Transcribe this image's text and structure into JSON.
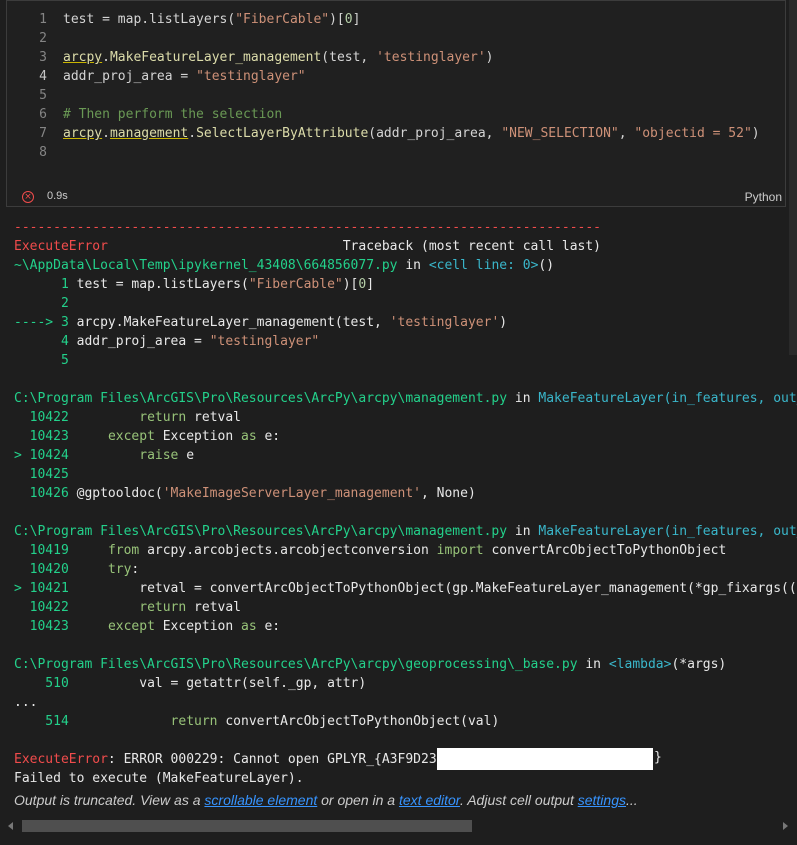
{
  "cell": {
    "lines": [
      {
        "num": "1",
        "parts": [
          [
            "op",
            "test = map.listLayers("
          ],
          [
            "str",
            "\"FiberCable\""
          ],
          [
            "op",
            ")["
          ],
          [
            "num",
            "0"
          ],
          [
            "op",
            "]"
          ]
        ]
      },
      {
        "num": "2",
        "parts": []
      },
      {
        "num": "3",
        "parts": [
          [
            "mod",
            "arcpy"
          ],
          [
            "op",
            "."
          ],
          [
            "k",
            "MakeFeatureLayer_management"
          ],
          [
            "op",
            "(test, "
          ],
          [
            "str",
            "'testinglayer'"
          ],
          [
            "op",
            ")"
          ]
        ]
      },
      {
        "num": "4",
        "parts": [
          [
            "op",
            "addr_proj_area = "
          ],
          [
            "str",
            "\"testinglayer\""
          ]
        ]
      },
      {
        "num": "5",
        "parts": []
      },
      {
        "num": "6",
        "parts": [
          [
            "com",
            "# Then perform the selection"
          ]
        ]
      },
      {
        "num": "7",
        "parts": [
          [
            "mod",
            "arcpy"
          ],
          [
            "op",
            "."
          ],
          [
            "mod",
            "management"
          ],
          [
            "op",
            "."
          ],
          [
            "k",
            "SelectLayerByAttribute"
          ],
          [
            "op",
            "(addr_proj_area, "
          ],
          [
            "str",
            "\"NEW_SELECTION\""
          ],
          [
            "op",
            ", "
          ],
          [
            "str",
            "\"objectid = 52\""
          ],
          [
            "op",
            ")"
          ]
        ]
      },
      {
        "num": "8",
        "parts": []
      }
    ],
    "exec_time": "0.9s",
    "language": "Python",
    "error_icon": "error-circle-icon"
  },
  "output": {
    "lines": [
      [
        [
          "red",
          "---------------------------------------------------------------------------"
        ]
      ],
      [
        [
          "red",
          "ExecuteError"
        ],
        [
          "white",
          "                              Traceback (most recent call last)"
        ]
      ],
      [
        [
          "green",
          "~\\AppData\\Local\\Temp\\ipykernel_43408\\664856077.py"
        ],
        [
          "white",
          " in "
        ],
        [
          "cyan",
          "<cell line: 0>"
        ],
        [
          "white",
          "()"
        ]
      ],
      [
        [
          "green",
          "      1 "
        ],
        [
          "white",
          "test = map.listLayers("
        ],
        [
          "str",
          "\"FiberCable\""
        ],
        [
          "white",
          ")["
        ],
        [
          "num",
          "0"
        ],
        [
          "white",
          "]"
        ]
      ],
      [
        [
          "green",
          "      2"
        ]
      ],
      [
        [
          "green",
          "----> 3 "
        ],
        [
          "white",
          "arcpy.MakeFeatureLayer_management(test, "
        ],
        [
          "str",
          "'testinglayer'"
        ],
        [
          "white",
          ")"
        ]
      ],
      [
        [
          "green",
          "      4 "
        ],
        [
          "white",
          "addr_proj_area = "
        ],
        [
          "str",
          "\"testinglayer\""
        ]
      ],
      [
        [
          "green",
          "      5"
        ]
      ],
      [],
      [
        [
          "green",
          "C:\\Program Files\\ArcGIS\\Pro\\Resources\\ArcPy\\arcpy\\management.py"
        ],
        [
          "white",
          " in "
        ],
        [
          "cyan",
          "MakeFeatureLayer(in_features, out_"
        ]
      ],
      [
        [
          "green",
          "  10422 "
        ],
        [
          "white",
          "        "
        ],
        [
          "rgreen",
          "return"
        ],
        [
          "white",
          " retval"
        ]
      ],
      [
        [
          "green",
          "  10423 "
        ],
        [
          "white",
          "    "
        ],
        [
          "rgreen",
          "except"
        ],
        [
          "white",
          " Exception "
        ],
        [
          "rgreen",
          "as"
        ],
        [
          "white",
          " e:"
        ]
      ],
      [
        [
          "green",
          "> 10424 "
        ],
        [
          "white",
          "        "
        ],
        [
          "rgreen",
          "raise"
        ],
        [
          "white",
          " e"
        ]
      ],
      [
        [
          "green",
          "  10425"
        ]
      ],
      [
        [
          "green",
          "  10426 "
        ],
        [
          "white",
          "@gptooldoc("
        ],
        [
          "str",
          "'MakeImageServerLayer_management'"
        ],
        [
          "white",
          ", None)"
        ]
      ],
      [],
      [
        [
          "green",
          "C:\\Program Files\\ArcGIS\\Pro\\Resources\\ArcPy\\arcpy\\management.py"
        ],
        [
          "white",
          " in "
        ],
        [
          "cyan",
          "MakeFeatureLayer(in_features, out_"
        ]
      ],
      [
        [
          "green",
          "  10419 "
        ],
        [
          "white",
          "    "
        ],
        [
          "rgreen",
          "from"
        ],
        [
          "white",
          " arcpy.arcobjects.arcobjectconversion "
        ],
        [
          "rgreen",
          "import"
        ],
        [
          "white",
          " convertArcObjectToPythonObject"
        ]
      ],
      [
        [
          "green",
          "  10420 "
        ],
        [
          "white",
          "    "
        ],
        [
          "rgreen",
          "try"
        ],
        [
          "white",
          ":"
        ]
      ],
      [
        [
          "green",
          "> 10421 "
        ],
        [
          "white",
          "        retval = convertArcObjectToPythonObject(gp.MakeFeatureLayer_management(*gp_fixargs((i"
        ]
      ],
      [
        [
          "green",
          "  10422 "
        ],
        [
          "white",
          "        "
        ],
        [
          "rgreen",
          "return"
        ],
        [
          "white",
          " retval"
        ]
      ],
      [
        [
          "green",
          "  10423 "
        ],
        [
          "white",
          "    "
        ],
        [
          "rgreen",
          "except"
        ],
        [
          "white",
          " Exception "
        ],
        [
          "rgreen",
          "as"
        ],
        [
          "white",
          " e:"
        ]
      ],
      [],
      [
        [
          "green",
          "C:\\Program Files\\ArcGIS\\Pro\\Resources\\ArcPy\\arcpy\\geoprocessing\\_base.py"
        ],
        [
          "white",
          " in "
        ],
        [
          "cyan",
          "<lambda>"
        ],
        [
          "white",
          "(*args)"
        ]
      ],
      [
        [
          "green",
          "    510 "
        ],
        [
          "white",
          "        val = getattr(self._gp, attr)"
        ]
      ],
      [
        [
          "white",
          "..."
        ]
      ],
      [
        [
          "green",
          "    514 "
        ],
        [
          "white",
          "            "
        ],
        [
          "rgreen",
          "return"
        ],
        [
          "white",
          " convertArcObjectToPythonObject(val)"
        ]
      ],
      [],
      [
        [
          "red",
          "ExecuteError"
        ],
        [
          "white",
          ": ERROR 000229: Cannot open GPLYR_{A3F9D237"
        ]
      ],
      [
        [
          "white",
          "Failed to execute (MakeFeatureLayer)."
        ]
      ]
    ],
    "closing_brace": "}"
  },
  "truncation": {
    "prefix": "Output is truncated. View as a ",
    "link1": "scrollable element",
    "mid1": " or open in a ",
    "link2": "text editor",
    "mid2": ". Adjust cell output ",
    "link3": "settings",
    "suffix": "..."
  }
}
